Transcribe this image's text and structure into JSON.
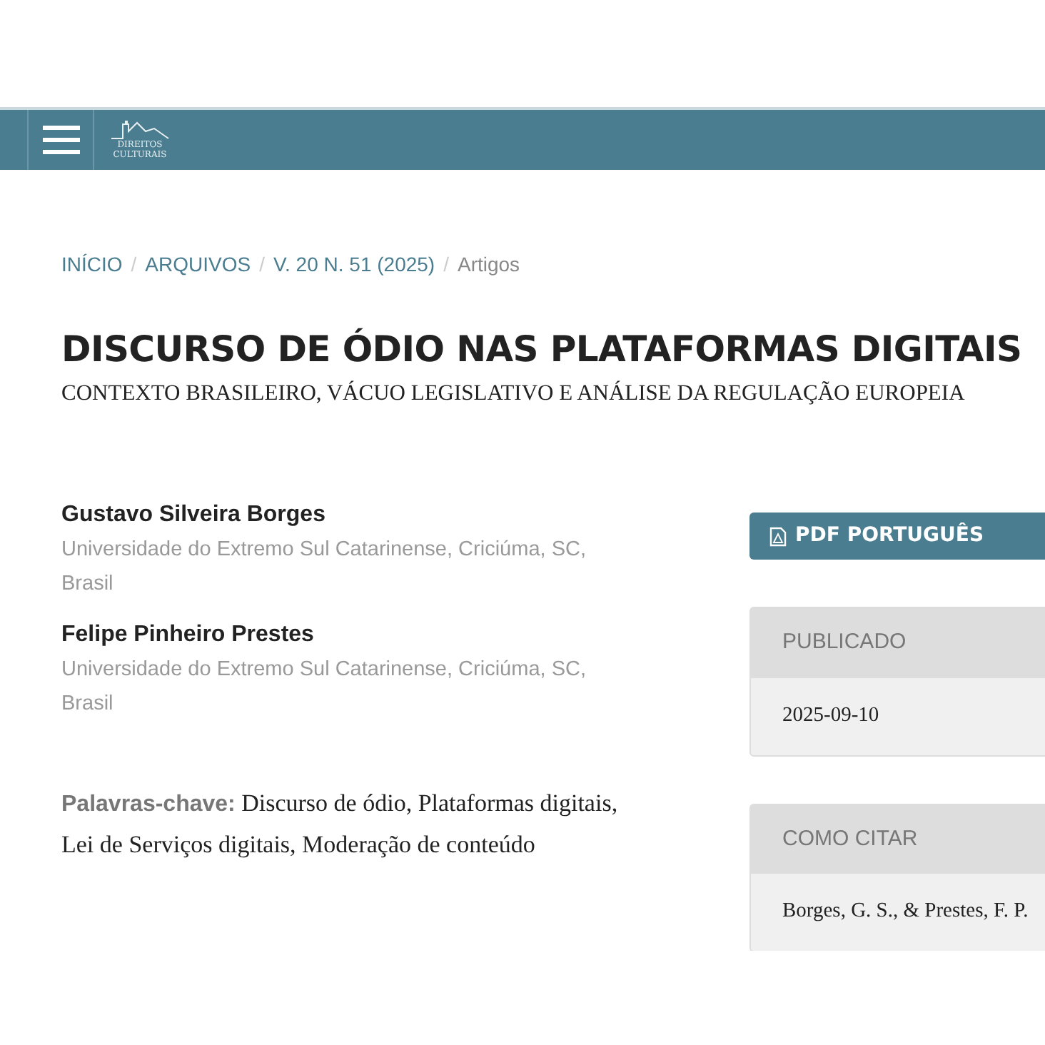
{
  "header": {
    "logo_lines": [
      "DIREITOS",
      "CULTURAIS"
    ]
  },
  "breadcrumb_separator": "/",
  "breadcrumb": [
    {
      "label": "INÍCIO",
      "link": true
    },
    {
      "label": "ARQUIVOS",
      "link": true
    },
    {
      "label": "V. 20 N. 51 (2025)",
      "link": true
    },
    {
      "label": "Artigos",
      "link": false
    }
  ],
  "title": "DISCURSO DE ÓDIO NAS PLATAFORMAS DIGITAIS",
  "subtitle": "CONTEXTO BRASILEIRO, VÁCUO LEGISLATIVO E ANÁLISE DA REGULAÇÃO EUROPEIA",
  "authors": [
    {
      "name": "Gustavo Silveira Borges",
      "affiliation": "Universidade do Extremo Sul Catarinense, Criciúma, SC, Brasil"
    },
    {
      "name": "Felipe Pinheiro Prestes",
      "affiliation": "Universidade do Extremo Sul Catarinense, Criciúma, SC, Brasil"
    }
  ],
  "keywords": {
    "label": "Palavras-chave:",
    "text": "Discurso de ódio, Plataformas digitais, Lei de Serviços digitais, Moderação de conteúdo"
  },
  "pdf_button": "PDF PORTUGUÊS",
  "panels": [
    {
      "heading": "PUBLICADO",
      "value": "2025-09-10"
    },
    {
      "heading": "COMO CITAR",
      "value": "Borges, G. S., & Prestes, F. P."
    }
  ]
}
